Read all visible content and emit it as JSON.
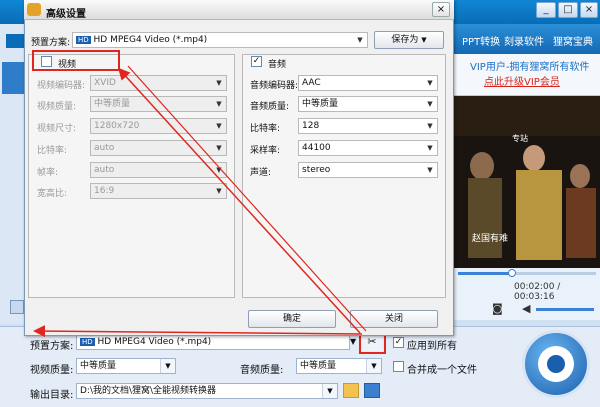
{
  "main": {
    "menu": [
      "PPT转换",
      "刻录软件",
      "狸窝宝典"
    ],
    "vip": {
      "line1": "VIP用户-拥有狸窝所有软件",
      "line2": "点此升级VIP会员"
    },
    "player": {
      "time": "00:02:00 / 00:03:16",
      "subtitle": "赵国有难"
    },
    "bottom": {
      "preset_label": "预置方案:",
      "preset_value": "HD MPEG4 Video (*.mp4)",
      "apply_all": "应用到所有",
      "video_quality_label": "视频质量:",
      "video_quality": "中等质量",
      "audio_quality_label": "音频质量:",
      "audio_quality": "中等质量",
      "merge_label": "合并成一个文件",
      "output_label": "输出目录:",
      "output_path": "D:\\我的文档\\狸窝\\全能视频转换器"
    }
  },
  "dialog": {
    "title": "高级设置",
    "preset_label": "预置方案:",
    "preset_value": "HD MPEG4 Video (*.mp4)",
    "save_as": "保存为",
    "video": {
      "label": "视频",
      "fields": [
        {
          "label": "视频编码器:",
          "value": "XVID"
        },
        {
          "label": "视频质量:",
          "value": "中等质量"
        },
        {
          "label": "视频尺寸:",
          "value": "1280x720"
        },
        {
          "label": "比特率:",
          "value": "auto"
        },
        {
          "label": "帧率:",
          "value": "auto"
        },
        {
          "label": "宽高比:",
          "value": "16:9"
        }
      ]
    },
    "audio": {
      "label": "音频",
      "fields": [
        {
          "label": "音频编码器:",
          "value": "AAC"
        },
        {
          "label": "音频质量:",
          "value": "中等质量"
        },
        {
          "label": "比特率:",
          "value": "128"
        },
        {
          "label": "采样率:",
          "value": "44100"
        },
        {
          "label": "声道:",
          "value": "stereo"
        }
      ]
    },
    "ok": "确定",
    "close": "关闭"
  },
  "colors": {
    "accent": "#0a6cb6",
    "annotation": "#e0261f",
    "vip_link": "#d7261b"
  }
}
